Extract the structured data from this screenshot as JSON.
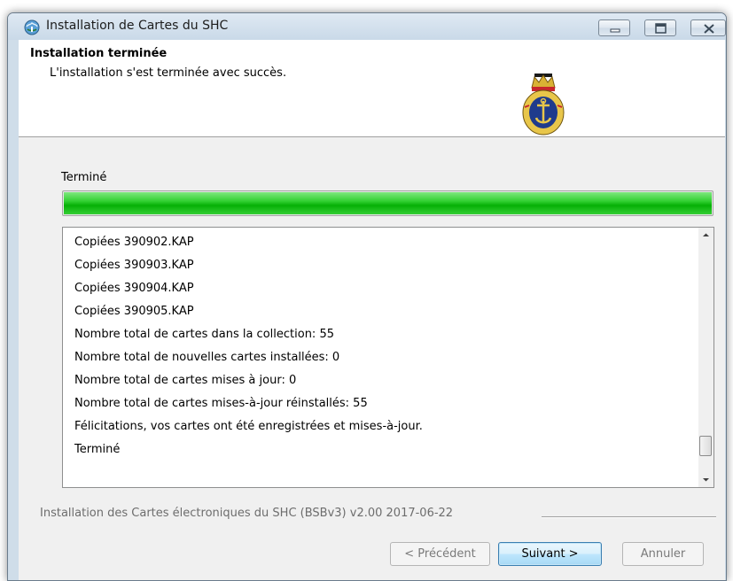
{
  "window": {
    "title": "Installation de Cartes du SHC",
    "icon": "installer-globe-icon"
  },
  "header": {
    "title": "Installation terminée",
    "subtitle": "L'installation s'est terminée avec succès.",
    "emblem": "chs-crest-icon"
  },
  "progress": {
    "label": "Terminé",
    "percent": 100,
    "color": "#06b006"
  },
  "log": {
    "lines": [
      "Copiées 390902.KAP",
      "Copiées 390903.KAP",
      "Copiées 390904.KAP",
      "Copiées 390905.KAP",
      "Nombre total de cartes dans la collection: 55",
      "Nombre total de nouvelles cartes installées: 0",
      "Nombre total de cartes mises à jour: 0",
      "Nombre total de cartes mises-à-jour réinstallés: 55",
      "Félicitations, vos cartes ont été enregistrées et mises-à-jour.",
      "Terminé"
    ]
  },
  "footer": {
    "branding": "Installation des Cartes électroniques du SHC (BSBv3) v2.00 2017-06-22"
  },
  "buttons": {
    "back": "< Précédent",
    "next": "Suivant >",
    "cancel": "Annuler"
  }
}
